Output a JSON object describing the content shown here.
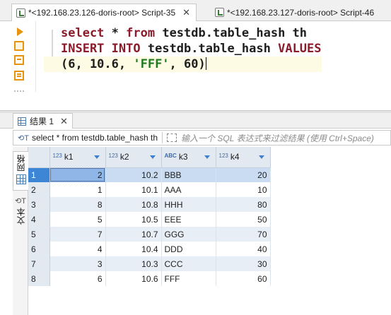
{
  "editor_tabs": [
    {
      "label": "*<192.168.23.126-doris-root> Script-35",
      "active": true
    },
    {
      "label": "*<192.168.23.127-doris-root> Script-46",
      "active": false
    }
  ],
  "editor": {
    "line1": {
      "kw1": "select",
      "mid": " * ",
      "kw2": "from",
      "rest": " testdb.table_hash th"
    },
    "line2": {
      "kw1": "INSERT",
      "mid": " ",
      "kw2": "INTO",
      "tbl": " testdb.table_hash ",
      "kw3": "VALUES"
    },
    "line3": {
      "open": "(6, 10.6, ",
      "str": "'FFF'",
      "close": ", 60)"
    }
  },
  "results_tab": {
    "label": "结果 1"
  },
  "filter": {
    "query": "select * from testdb.table_hash th",
    "placeholder": "输入一个 SQL 表达式来过滤结果 (使用 Ctrl+Space)"
  },
  "side_tabs": {
    "grid": "网格",
    "text": "文本"
  },
  "grid": {
    "columns": [
      {
        "badge": "123",
        "name": "k1"
      },
      {
        "badge": "123",
        "name": "k2"
      },
      {
        "badge": "ABC",
        "name": "k3"
      },
      {
        "badge": "123",
        "name": "k4"
      }
    ],
    "rows": [
      {
        "n": "1",
        "k1": "2",
        "k2": "10.2",
        "k3": "BBB",
        "k4": "20"
      },
      {
        "n": "2",
        "k1": "1",
        "k2": "10.1",
        "k3": "AAA",
        "k4": "10"
      },
      {
        "n": "3",
        "k1": "8",
        "k2": "10.8",
        "k3": "HHH",
        "k4": "80"
      },
      {
        "n": "4",
        "k1": "5",
        "k2": "10.5",
        "k3": "EEE",
        "k4": "50"
      },
      {
        "n": "5",
        "k1": "7",
        "k2": "10.7",
        "k3": "GGG",
        "k4": "70"
      },
      {
        "n": "6",
        "k1": "4",
        "k2": "10.4",
        "k3": "DDD",
        "k4": "40"
      },
      {
        "n": "7",
        "k1": "3",
        "k2": "10.3",
        "k3": "CCC",
        "k4": "30"
      },
      {
        "n": "8",
        "k1": "6",
        "k2": "10.6",
        "k3": "FFF",
        "k4": "60"
      }
    ]
  },
  "colors": {
    "keyword": "#8b1a2b",
    "string": "#1d7a1d",
    "row_alt": "#e8eef6",
    "selection": "#3d86d6"
  }
}
